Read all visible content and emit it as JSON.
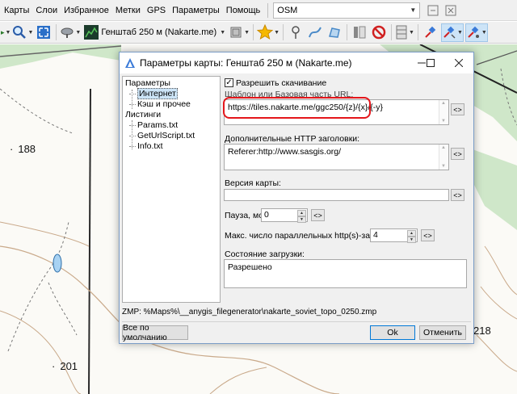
{
  "menu": {
    "items": [
      "Карты",
      "Слои",
      "Избранное",
      "Метки",
      "GPS",
      "Параметры",
      "Помощь"
    ],
    "map_type_value": "OSM"
  },
  "toolbar": {
    "current_map_label": "Генштаб 250 м (Nakarte.me)"
  },
  "map": {
    "labels": [
      "188",
      "201",
      "218"
    ]
  },
  "dialog": {
    "title": "Параметры карты: Генштаб 250 м (Nakarte.me)",
    "tree": {
      "group_params": "Параметры",
      "internet": "Интернет",
      "cache": "Кэш и прочее",
      "group_listings": "Листинги",
      "params_txt": "Params.txt",
      "geturlscript": "GetUrlScript.txt",
      "info_txt": "Info.txt"
    },
    "allow_download_label": "Разрешить скачивание",
    "allow_download_checked": true,
    "url_template_label": "Шаблон или Базовая часть URL:",
    "url_template_value": "https://tiles.nakarte.me/ggc250/{z}/{x}/{-y}",
    "http_headers_label": "Дополнительные HTTP заголовки:",
    "http_headers_value": "Referer:http://www.sasgis.org/",
    "map_version_label": "Версия карты:",
    "map_version_value": "",
    "pause_label": "Пауза, мс:",
    "pause_value": "0",
    "max_requests_label": "Макс. число параллельных http(s)-запросов:",
    "max_requests_value": "4",
    "load_state_label": "Состояние загрузки:",
    "load_state_value": "Разрешено",
    "insert_button": "<>",
    "zmp_path": "ZMP:  %Maps%\\__anygis_filegenerator\\nakarte_soviet_topo_0250.zmp",
    "defaults_button": "Все по умолчанию",
    "ok_button": "Ok",
    "cancel_button": "Отменить"
  },
  "colors": {
    "highlight": "#e4161b",
    "map_green": "#cfe7c9",
    "selection": "#cce4f7"
  }
}
